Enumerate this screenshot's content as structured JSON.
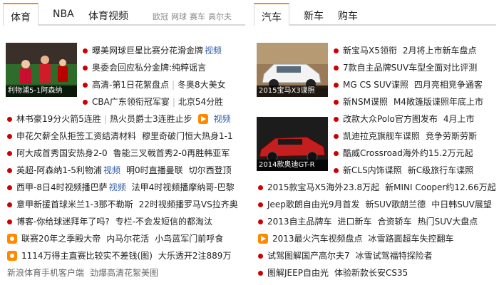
{
  "left": {
    "tabs": [
      "体育",
      "NBA",
      "体育视频"
    ],
    "subtabs": [
      "欧冠",
      "网球",
      "赛车",
      "高尔夫"
    ],
    "photo_caption": "利物浦5-1阿森纳",
    "top_lines": [
      [
        "曝美网球巨星比赛分花滑金牌",
        "视频"
      ],
      [
        "奥委会回应私分金牌:纯粹谣言",
        ""
      ],
      [
        "高清-第1日花絮盘点",
        "冬奥8大美女"
      ],
      [
        "CBA广东领衔冠军宴",
        "北京54分胜"
      ]
    ],
    "lines": [
      [
        "林书豪19分火箭5连胜",
        "热火员爵士3连胜止步",
        "视频"
      ],
      [
        "申花欠薪全队拒签工资结清材料",
        "穆里奇破门恒大热身1-1"
      ],
      [
        "阿大成首秀国安热身2-0",
        "鲁能三叉戟首秀2-0再胜韩亚军"
      ],
      [
        "英超-阿森纳1-5利物浦",
        "视频",
        "明0时直播曼联",
        "切尔西登顶"
      ],
      [
        "西甲-8日4时视频播巴萨",
        "视频",
        "法甲4时视频播摩纳哥-巴黎"
      ],
      [
        "意甲新援首球米兰1-3那不勒斯",
        "22时视频播罗马VS拉齐奥"
      ],
      [
        "博客-你给球迷拜年了吗?",
        "专栏-不会发短信的都淘汰"
      ],
      [
        "联赛20年之季殿大帝",
        "内马尔花活",
        "小鸟蓝军门前呼食"
      ],
      [
        "1114万得主直赛比较实不差钱(图)",
        "大乐透开2注889万"
      ],
      [
        "新浪体育手机客户端",
        "劲爆高清花絮美图"
      ]
    ]
  },
  "right": {
    "tabs": [
      "汽车",
      "新车",
      "购车"
    ],
    "photo1_caption": "2015宝马X3谍照",
    "photo2_caption": "2014款奥迪GT-R",
    "top_lines": [
      [
        "新宝马X5领衔",
        "2月将上市新车盘点"
      ],
      [
        "7款自主品牌SUV车型全面对比评测",
        ""
      ],
      [
        "MG CS SUV谍照",
        "四月亮相竞争通客"
      ],
      [
        "新NSM谍照",
        "M4敞篷版谍照年底上市"
      ]
    ],
    "mid_lines": [
      [
        "改款大众Polo官方图发布",
        "4月上市"
      ],
      [
        "凯迪拉克旗舰车谍照",
        "竞争劳斯劳斯"
      ],
      [
        "酷威Crossroad海外约15.2万元起",
        ""
      ],
      [
        "新CLS内饰谍照",
        "新C级旅行车谍照"
      ]
    ],
    "lines": [
      [
        "2015款宝马X5海外23.8万起",
        "新MINI Cooper约12.66万起"
      ],
      [
        "Jeep歌朗自由光9月首发",
        "新SUV歌朗兰德",
        "中日韩SUV展望"
      ],
      [
        "2013自主品牌车",
        "进口新车",
        "合资轿车",
        "热门SUV大盘点"
      ],
      [
        "2013最火汽车视频盘点",
        "冰雪路面超车失控翻车"
      ],
      [
        "试驾图解国产高尔夫7",
        "冰雪试驾福特探险者"
      ],
      [
        "图解JEEP自由光",
        "体验新款长安CS35"
      ]
    ]
  }
}
